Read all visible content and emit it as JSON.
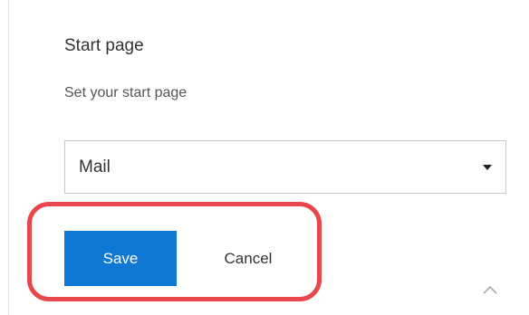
{
  "settings": {
    "start_page": {
      "title": "Start page",
      "description": "Set your start page",
      "select": {
        "selected_value": "Mail"
      }
    },
    "actions": {
      "save_label": "Save",
      "cancel_label": "Cancel"
    }
  },
  "icons": {
    "dropdown": "caret-down-icon",
    "collapse": "chevron-up-icon"
  },
  "colors": {
    "primary_button": "#0f78d4",
    "highlight_annotation": "#e8474d",
    "select_border": "#c8c8c8"
  }
}
